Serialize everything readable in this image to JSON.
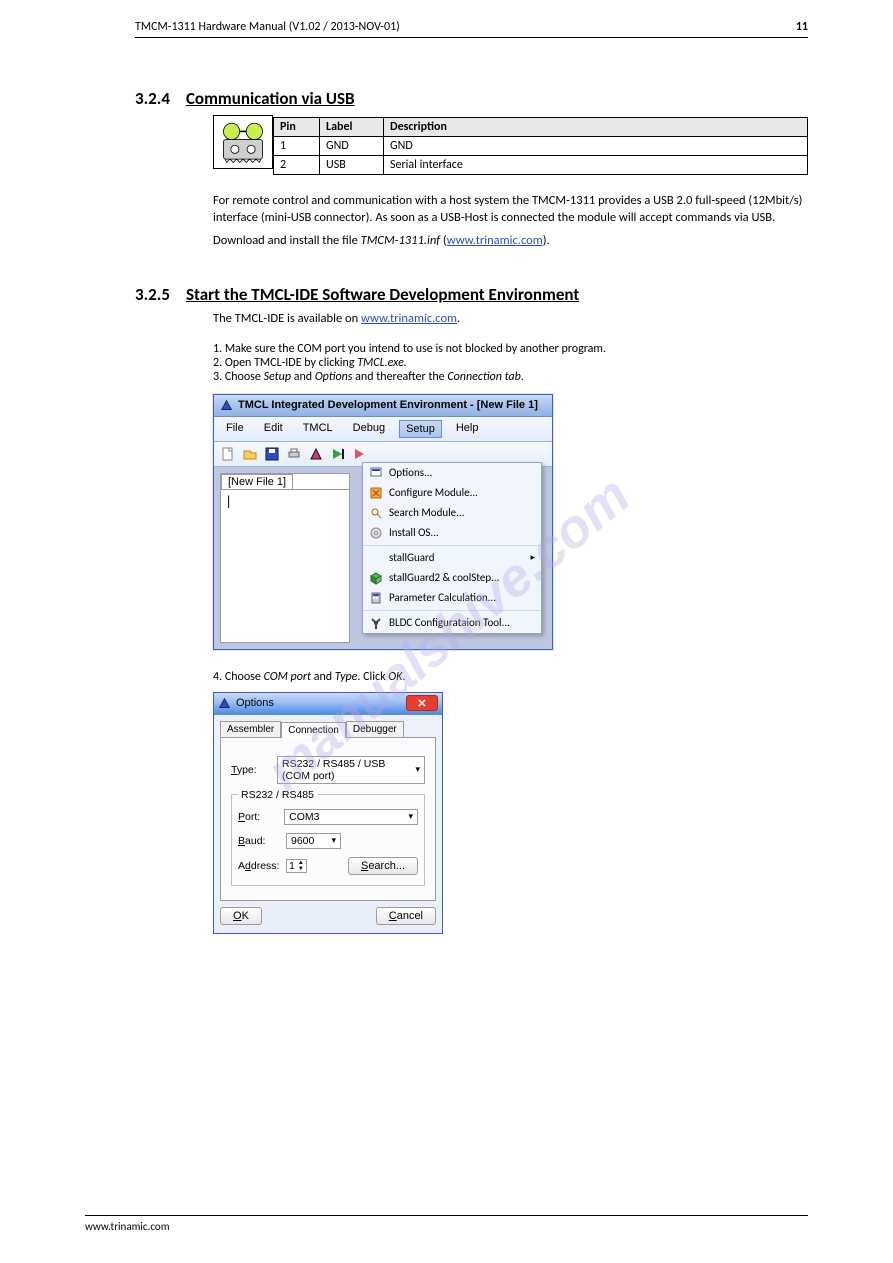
{
  "header": {
    "left": "TMCM-1311 Hardware Manual (V1.02 / 2013-NOV-01)",
    "right": "11"
  },
  "footer": {
    "left": "www.trinamic.com",
    "right": ""
  },
  "sec1": {
    "num": "3.2.4",
    "title": "Communication via USB",
    "pin_table": {
      "headers": [
        "Pin",
        "Label",
        "Description"
      ],
      "rows": [
        [
          "1",
          "GND",
          "GND"
        ],
        [
          "2",
          "USB",
          "Serial interface"
        ]
      ]
    },
    "icon_alt": "usb-connector"
  },
  "text1": "For remote control and communication with a host system the TMCM-1311 provides a USB 2.0 full-speed (12Mbit/s) interface (mini-USB connector). As soon as a USB-Host is connected the module will accept commands via USB.",
  "text2_prefix": "Download and install the file ",
  "text2_file": "TMCM-1311.inf",
  "text2_link_prefix": " (",
  "text2_link": "www.trinamic.com",
  "text2_suffix": ").",
  "steps_title": {
    "num": "3.2.5",
    "title": "Start the TMCL-IDE Software Development Environment"
  },
  "steps_intro": "The TMCL-IDE is available on ",
  "steps_intro_link": "www.trinamic.com",
  "steps_intro_suffix": ".",
  "step1": "1.  Make sure the COM port you intend to use is not blocked by another program.",
  "step2": "2.  Open TMCL-IDE by clicking ",
  "step2_obj": "TMCL.exe.",
  "step3_1": "3.  Choose ",
  "step3_2": "Setup",
  "step3_3": " and ",
  "step3_4": "Options",
  "step3_5": " and thereafter the ",
  "step3_6": "Connection tab",
  "step3_7": ".",
  "fig1": {
    "title": "TMCL Integrated Development Environment - [New File 1]",
    "menu": [
      "File",
      "Edit",
      "TMCL",
      "Debug",
      "Setup",
      "Help"
    ],
    "tab": "[New File 1]",
    "editor": "|",
    "dropdown": [
      "Options...",
      "Configure Module...",
      "Search Module...",
      "Install OS...",
      "__sep__",
      "stallGuard",
      "stallGuard2 & coolStep...",
      "Parameter Calculation...",
      "__sep__",
      "BLDC Configurataion Tool..."
    ]
  },
  "step4_1": "4.  Choose ",
  "step4_2": "COM port",
  "step4_3": " and ",
  "step4_4": "Type",
  "step4_5": ". Click ",
  "step4_6": "OK",
  "step4_7": ".",
  "dlg": {
    "title": "Options",
    "tabs": [
      "Assembler",
      "Connection",
      "Debugger"
    ],
    "active_tab": 1,
    "type_label": "Type:",
    "type_value": "RS232 / RS485 / USB (COM port)",
    "group": "RS232 / RS485",
    "port_label": "Port:",
    "port_value": "COM3",
    "baud_label": "Baud:",
    "baud_value": "9600",
    "addr_label": "Address:",
    "addr_value": "1",
    "search": "Search...",
    "ok": "OK",
    "cancel": "Cancel"
  }
}
